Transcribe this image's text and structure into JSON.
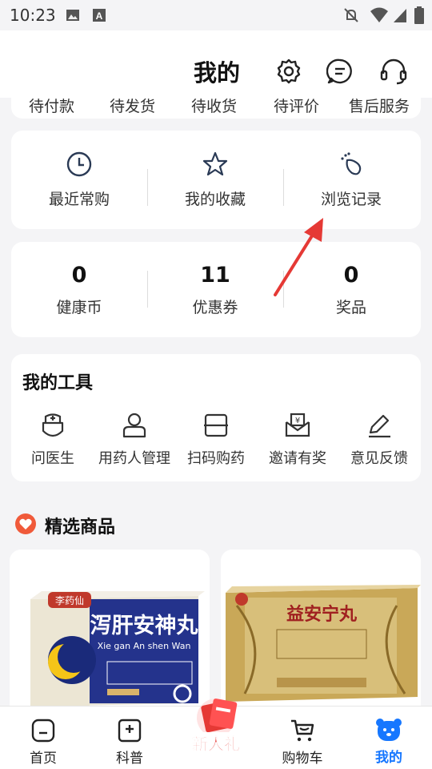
{
  "status_bar": {
    "time": "10:23"
  },
  "header": {
    "title": "我的"
  },
  "orders": [
    "待付款",
    "待发货",
    "待收货",
    "待评价",
    "售后服务"
  ],
  "quick": {
    "recent": "最近常购",
    "favorites": "我的收藏",
    "history": "浏览记录"
  },
  "stats": [
    {
      "value": "0",
      "label": "健康币"
    },
    {
      "value": "11",
      "label": "优惠券"
    },
    {
      "value": "0",
      "label": "奖品"
    }
  ],
  "tools": {
    "title": "我的工具",
    "items": [
      "问医生",
      "用药人管理",
      "扫码购药",
      "邀请有奖",
      "意见反馈"
    ]
  },
  "featured": {
    "title": "精选商品",
    "products": [
      {
        "brand": "李药仙",
        "name": "泻肝安神丸",
        "pinyin": "Xie gan An shen Wan"
      },
      {
        "name": "益安宁丸"
      }
    ]
  },
  "bottom_nav": {
    "home": "首页",
    "science": "科普",
    "gift": "新人礼",
    "cart": "购物车",
    "mine": "我的"
  },
  "colors": {
    "accent": "#1677ff",
    "arrow": "#e53935",
    "heart": "#f05a3a"
  }
}
